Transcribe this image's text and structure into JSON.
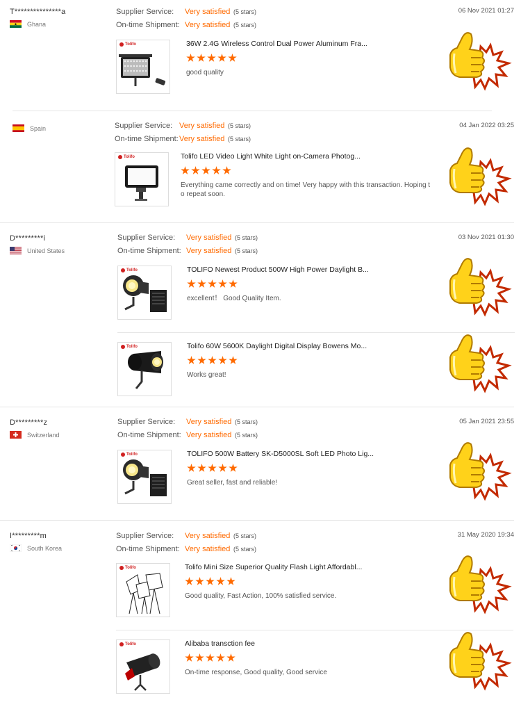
{
  "labels": {
    "supplier": "Supplier Service:",
    "shipment": "On-time Shipment:",
    "rating_text": "Very satisfied",
    "stars_text": "(5 stars)"
  },
  "colors": {
    "accent": "#ff6a00",
    "thumb": "#ffd21a"
  },
  "reviews": [
    {
      "buyer": "T***************a",
      "country": "Ghana",
      "flag": "ghana",
      "date": "06 Nov 2021 01:27",
      "products": [
        {
          "title": "36W 2.4G Wireless Control Dual Power Aluminum Fra...",
          "comment": "good quality",
          "stars": 5,
          "image": "panel-light"
        }
      ]
    },
    {
      "buyer": "",
      "country": "Spain",
      "flag": "spain",
      "date": "04 Jan 2022 03:25",
      "products": [
        {
          "title": "Tolifo LED Video Light White Light on-Camera Photog...",
          "comment": "Everything came correctly and on time! Very happy with this transaction. Hoping t o repeat soon.",
          "stars": 5,
          "image": "video-light"
        }
      ]
    },
    {
      "buyer": "D*********i",
      "country": "United States",
      "flag": "usa",
      "date": "03 Nov 2021 01:30",
      "products": [
        {
          "title": "TOLIFO Newest Product 500W High Power Daylight B...",
          "comment": "excellent！ Good Quality Item.",
          "stars": 5,
          "image": "cob-light"
        },
        {
          "title": "Tolifo 60W 5600K Daylight Digital Display Bowens Mo...",
          "comment": "Works great!",
          "stars": 5,
          "image": "mono-light"
        }
      ]
    },
    {
      "buyer": "D*********z",
      "country": "Switzerland",
      "flag": "swiss",
      "date": "05 Jan 2021 23:55",
      "products": [
        {
          "title": "TOLIFO 500W Battery SK-D5000SL Soft LED Photo Lig...",
          "comment": "Great seller, fast and reliable!",
          "stars": 5,
          "image": "cob-light"
        }
      ]
    },
    {
      "buyer": "I*********m",
      "country": "South Korea",
      "flag": "korea",
      "date": "31 May 2020 19:34",
      "products": [
        {
          "title": "Tolifo Mini Size Superior Quality Flash Light Affordabl...",
          "comment": "Good quality, Fast Action, 100% satisfied service.",
          "stars": 5,
          "image": "softbox-kit"
        },
        {
          "title": "Alibaba transction fee",
          "comment": "On-time response, Good quality, Good service",
          "stars": 5,
          "image": "flash-head"
        }
      ]
    }
  ]
}
